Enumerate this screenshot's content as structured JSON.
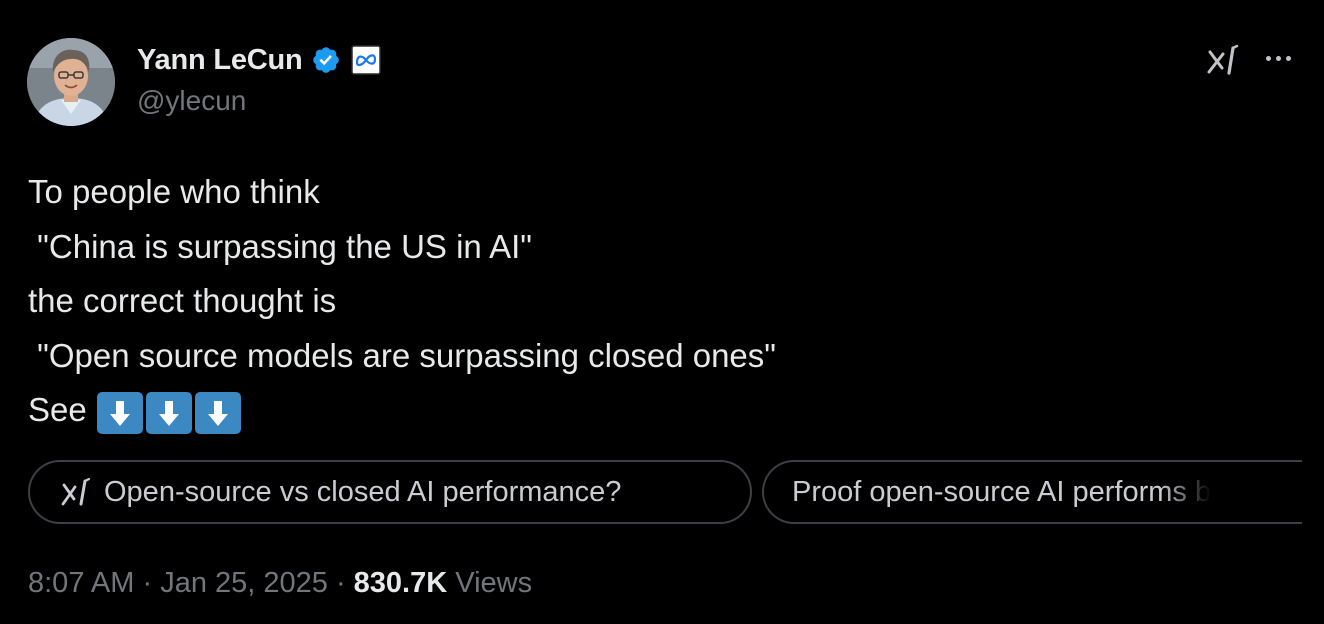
{
  "author": {
    "display_name": "Yann LeCun",
    "handle": "@ylecun",
    "verified_icon": "verified-badge-icon",
    "affiliate_icon": "meta-affiliate-icon",
    "verified_color": "#1d9bf0"
  },
  "header_actions": {
    "grok_icon": "grok-icon",
    "more_icon": "more-options-icon"
  },
  "tweet": {
    "lines": [
      "To people who think",
      " \"China is surpassing the US in AI\"",
      "the correct thought is",
      " \"Open source models are surpassing closed ones\"",
      "See"
    ],
    "emoji": [
      "down-arrow-emoji",
      "down-arrow-emoji",
      "down-arrow-emoji"
    ],
    "emoji_color": "#3b88c3"
  },
  "grok_suggestions": [
    {
      "label": "Open-source vs closed AI performance?",
      "icon": "grok-icon"
    },
    {
      "label": "Proof open-source AI performs b"
    }
  ],
  "footer": {
    "time": "8:07 AM",
    "separator": " · ",
    "date": "Jan 25, 2025",
    "views_count": "830.7K",
    "views_label": " Views"
  },
  "colors": {
    "background": "#000000",
    "text_primary": "#e7e9ea",
    "text_secondary": "#71767b",
    "chip_border": "#3c4045"
  }
}
